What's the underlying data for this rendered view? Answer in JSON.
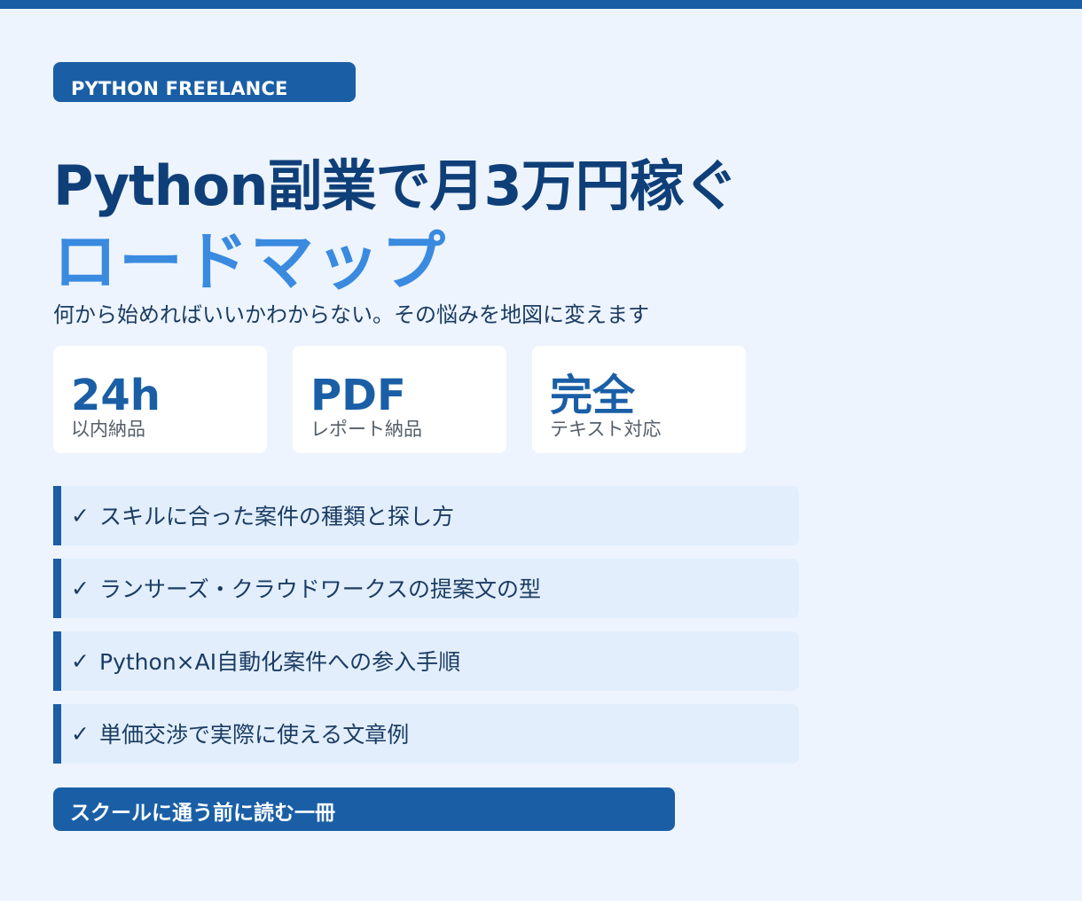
{
  "colors": {
    "accent": "#1a5fa6",
    "title": "#0f3f78",
    "highlight": "#3a8ae0",
    "background": "#edf4fd",
    "item_background": "#e2eefb"
  },
  "badge": "PYTHON FREELANCE",
  "title": {
    "line1": "Python副業で月3万円稼ぐ",
    "line2": "ロードマップ"
  },
  "subtitle": "何から始めればいいかわからない。その悩みを地図に変えます",
  "stats": [
    {
      "value": "24h",
      "label": "以内納品"
    },
    {
      "value": "PDF",
      "label": "レポート納品"
    },
    {
      "value": "完全",
      "label": "テキスト対応"
    }
  ],
  "checklist": {
    "mark": "✓",
    "items": [
      "スキルに合った案件の種類と探し方",
      "ランサーズ・クラウドワークスの提案文の型",
      "Python×AI自動化案件への参入手順",
      "単価交渉で実際に使える文章例"
    ]
  },
  "cta": "スクールに通う前に読む一冊"
}
